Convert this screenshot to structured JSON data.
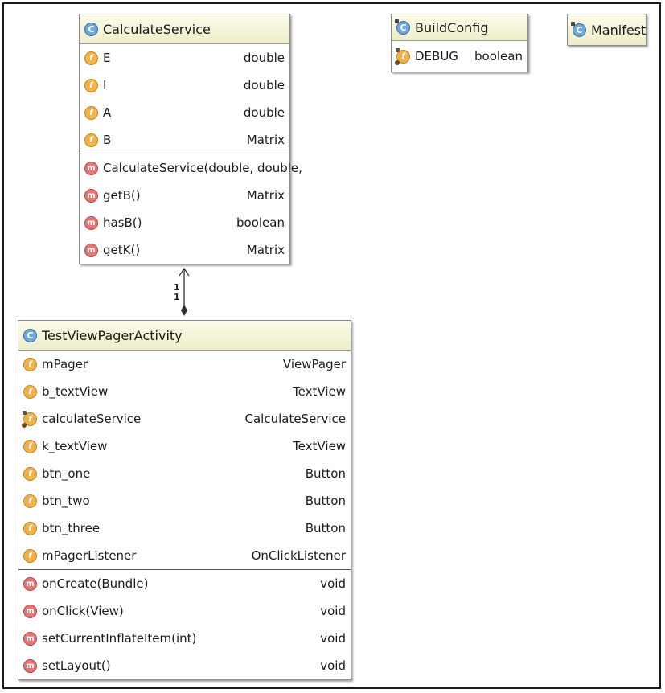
{
  "classes": {
    "calculate_service": {
      "name": "CalculateService",
      "fields": [
        {
          "name": "E",
          "type": "double"
        },
        {
          "name": "I",
          "type": "double"
        },
        {
          "name": "A",
          "type": "double"
        },
        {
          "name": "B",
          "type": "Matrix"
        }
      ],
      "methods": [
        {
          "name": "CalculateService(double, double,",
          "type": ""
        },
        {
          "name": "getB()",
          "type": "Matrix"
        },
        {
          "name": "hasB()",
          "type": "boolean"
        },
        {
          "name": "getK()",
          "type": "Matrix"
        }
      ]
    },
    "build_config": {
      "name": "BuildConfig",
      "fields": [
        {
          "name": "DEBUG",
          "type": "boolean"
        }
      ]
    },
    "manifest": {
      "name": "Manifest"
    },
    "test_view_pager_activity": {
      "name": "TestViewPagerActivity",
      "fields": [
        {
          "name": "mPager",
          "type": "ViewPager"
        },
        {
          "name": "b_textView",
          "type": "TextView"
        },
        {
          "name": "calculateService",
          "type": "CalculateService"
        },
        {
          "name": "k_textView",
          "type": "TextView"
        },
        {
          "name": "btn_one",
          "type": "Button"
        },
        {
          "name": "btn_two",
          "type": "Button"
        },
        {
          "name": "btn_three",
          "type": "Button"
        },
        {
          "name": "mPagerListener",
          "type": "OnClickListener"
        }
      ],
      "methods": [
        {
          "name": "onCreate(Bundle)",
          "type": "void"
        },
        {
          "name": "onClick(View)",
          "type": "void"
        },
        {
          "name": "setCurrentInflateItem(int)",
          "type": "void"
        },
        {
          "name": "setLayout()",
          "type": "void"
        }
      ]
    }
  },
  "association": {
    "multiplicity_top": "1",
    "multiplicity_bottom": "1"
  },
  "icons": {
    "class": "class-c-icon",
    "field": "field-f-icon",
    "method": "method-m-icon"
  },
  "icon_letters": {
    "class": "C",
    "field": "f",
    "method": "m"
  },
  "colors": {
    "header_bg": "#f2f2d5",
    "field_icon": "#f2b24a",
    "method_icon": "#e77777",
    "class_icon": "#6fa8dc"
  }
}
